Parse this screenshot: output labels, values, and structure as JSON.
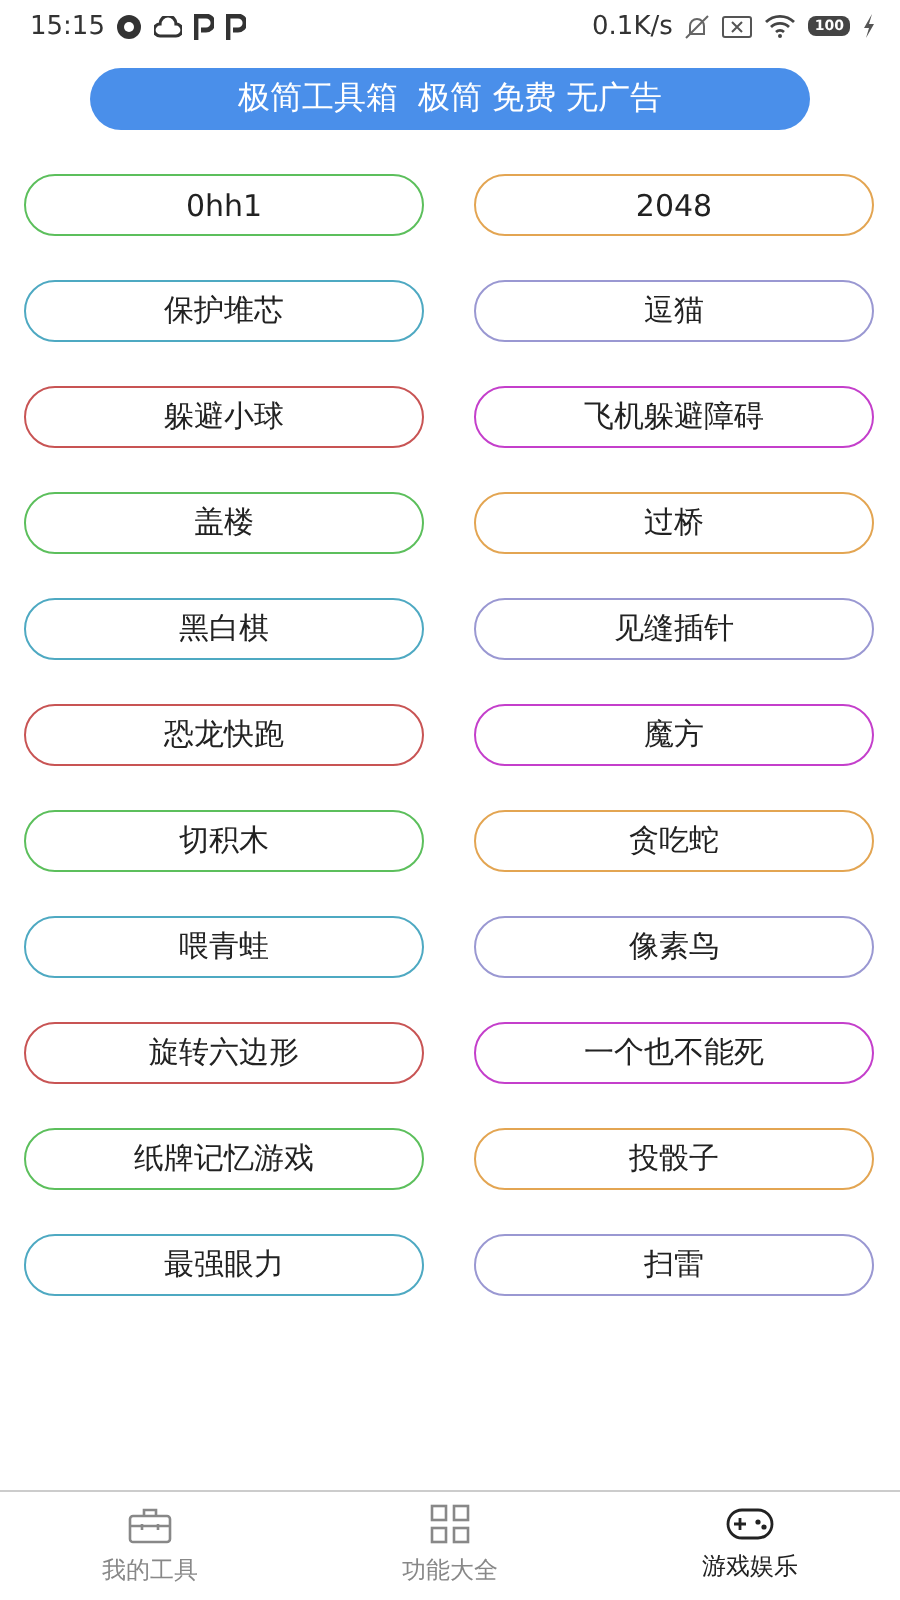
{
  "status_bar": {
    "time": "15:15",
    "speed": "0.1K/s",
    "battery": "100"
  },
  "banner": {
    "text": "极简工具箱  极简 免费 无广告"
  },
  "games": [
    {
      "label": "0hh1",
      "color": "#5cbf5c"
    },
    {
      "label": "2048",
      "color": "#e3a552"
    },
    {
      "label": "保护堆芯",
      "color": "#4ea9c2"
    },
    {
      "label": "逗猫",
      "color": "#9a98d2"
    },
    {
      "label": "躲避小球",
      "color": "#c85454"
    },
    {
      "label": "飞机躲避障碍",
      "color": "#c43fcb"
    },
    {
      "label": "盖楼",
      "color": "#5cbf5c"
    },
    {
      "label": "过桥",
      "color": "#e3a552"
    },
    {
      "label": "黑白棋",
      "color": "#4ea9c2"
    },
    {
      "label": "见缝插针",
      "color": "#9a98d2"
    },
    {
      "label": "恐龙快跑",
      "color": "#c85454"
    },
    {
      "label": "魔方",
      "color": "#c43fcb"
    },
    {
      "label": "切积木",
      "color": "#5cbf5c"
    },
    {
      "label": "贪吃蛇",
      "color": "#e3a552"
    },
    {
      "label": "喂青蛙",
      "color": "#4ea9c2"
    },
    {
      "label": "像素鸟",
      "color": "#9a98d2"
    },
    {
      "label": "旋转六边形",
      "color": "#c85454"
    },
    {
      "label": "一个也不能死",
      "color": "#c43fcb"
    },
    {
      "label": "纸牌记忆游戏",
      "color": "#5cbf5c"
    },
    {
      "label": "投骰子",
      "color": "#e3a552"
    },
    {
      "label": "最强眼力",
      "color": "#4ea9c2"
    },
    {
      "label": "扫雷",
      "color": "#9a98d2"
    }
  ],
  "bottom_nav": [
    {
      "label": "我的工具",
      "kind": "toolbox",
      "selected": false
    },
    {
      "label": "功能大全",
      "kind": "grid",
      "selected": false
    },
    {
      "label": "游戏娱乐",
      "kind": "gamepad",
      "selected": true
    }
  ]
}
